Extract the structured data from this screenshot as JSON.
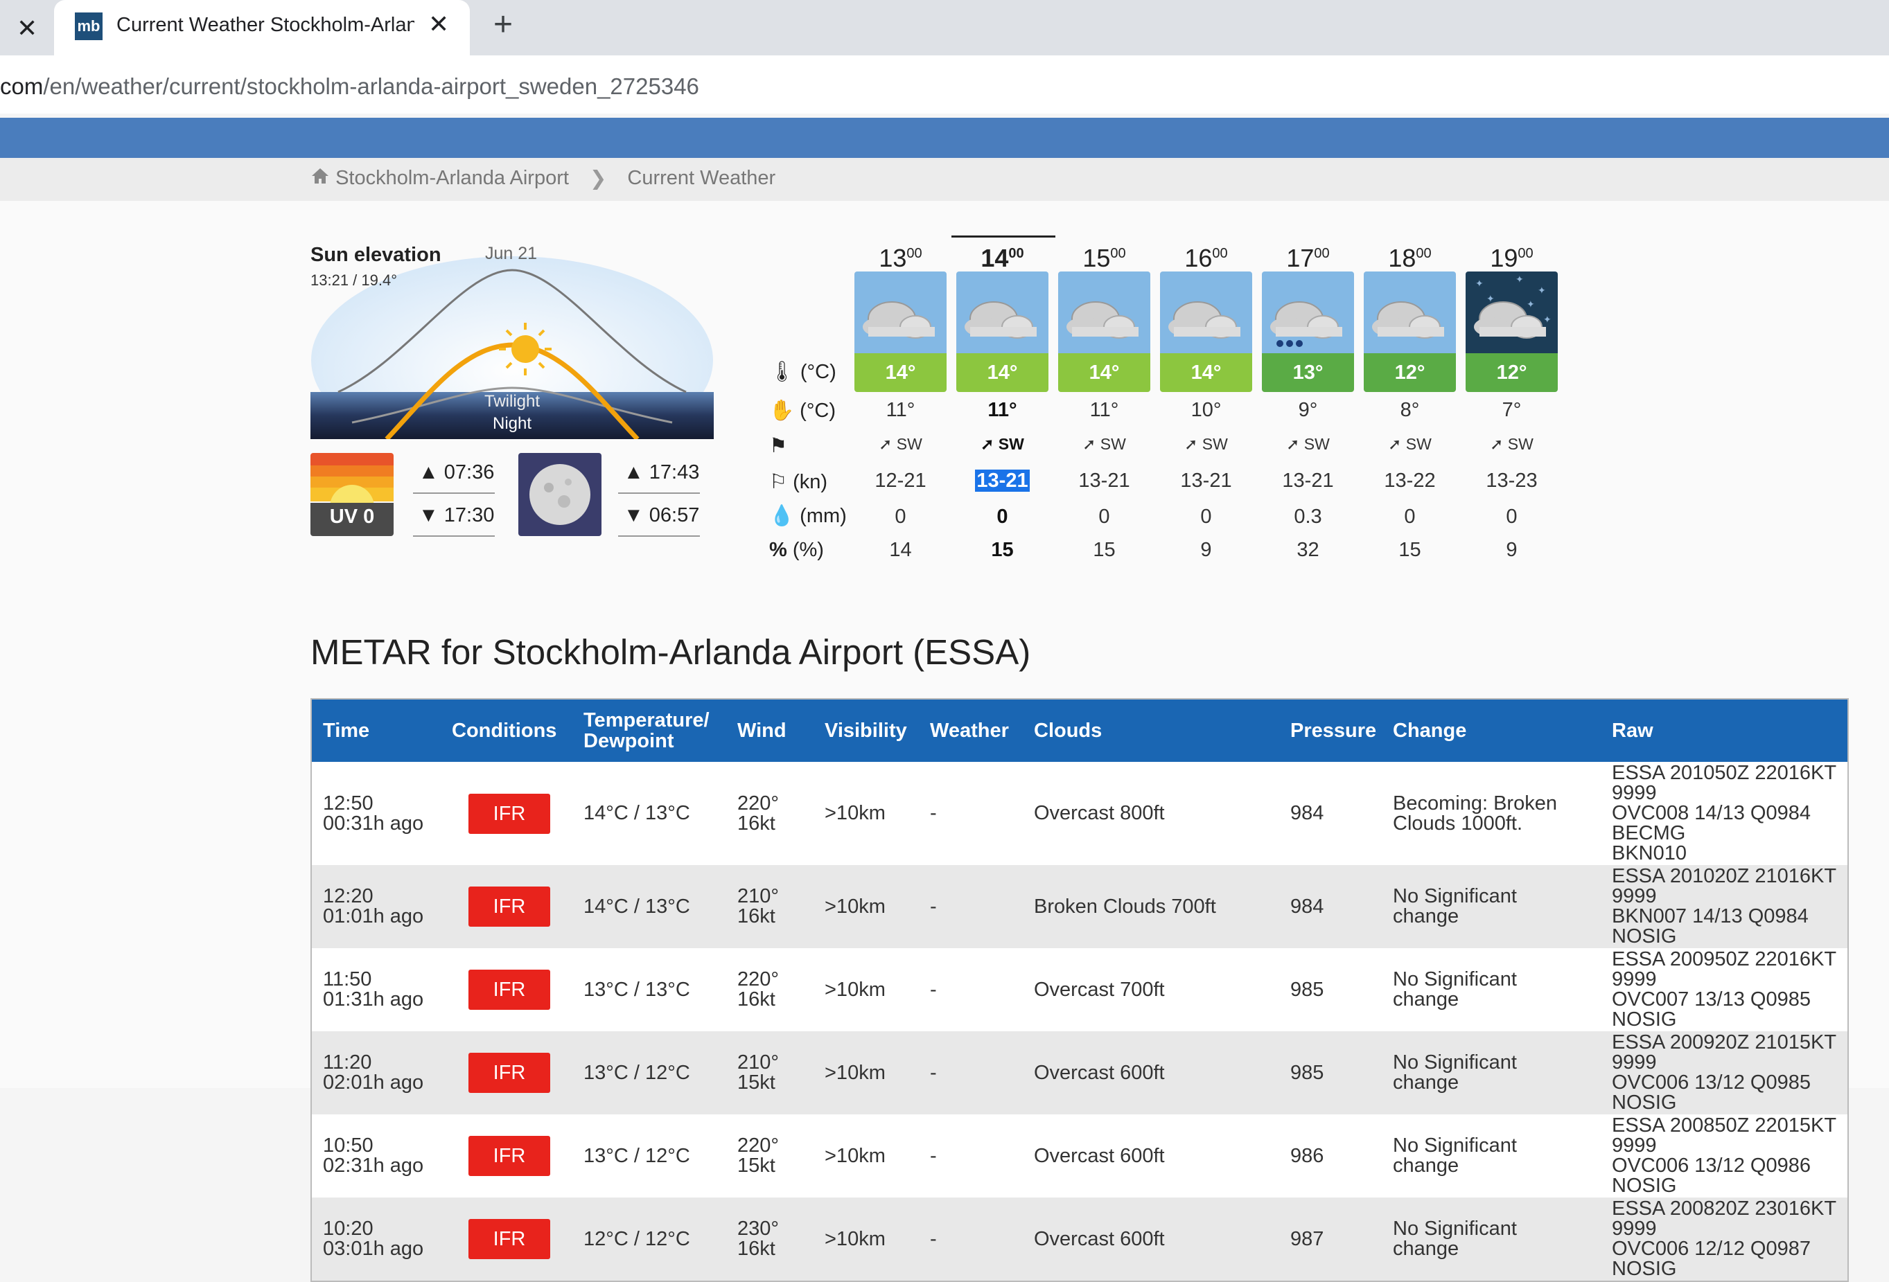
{
  "browser": {
    "prev_tab_close": "✕",
    "tab_title": "Current Weather Stockholm-Arlanda Airport",
    "tab_close": "✕",
    "favicon": "mb",
    "new_tab": "+",
    "url_host": "com",
    "url_path": "/en/weather/current/stockholm-arlanda-airport_sweden_2725346"
  },
  "breadcrumb": {
    "home_icon": "house-icon",
    "item1": "Stockholm-Arlanda Airport",
    "separator": "❯",
    "item2": "Current Weather"
  },
  "sun": {
    "title": "Sun elevation",
    "subtitle": "13:21 / 19.4°",
    "date": "Jun 21",
    "twilight": "Twilight",
    "night": "Night",
    "uv": "UV 0",
    "sunrise": "▲ 07:36",
    "sunset": "▼ 17:30",
    "moonrise": "▲ 17:43",
    "moonset": "▼ 06:57"
  },
  "row_labels": {
    "temp": "(°C)",
    "felt": "(°C)",
    "wind": "(kn)",
    "precip": "(mm)",
    "prob": "(%)"
  },
  "forecast": [
    {
      "hour": "13",
      "min": "00",
      "temp": "14°",
      "felt": "11°",
      "dir": "SW",
      "wind": "12-21",
      "precip": "0",
      "prob": "14",
      "tile": "#83b8e4",
      "tcolor": "#8cc63f",
      "icon": "cloud-icon"
    },
    {
      "hour": "14",
      "min": "00",
      "temp": "14°",
      "felt": "11°",
      "dir": "SW",
      "wind": "13-21",
      "precip": "0",
      "prob": "15",
      "tile": "#83b8e4",
      "tcolor": "#8cc63f",
      "icon": "cloud-icon"
    },
    {
      "hour": "15",
      "min": "00",
      "temp": "14°",
      "felt": "11°",
      "dir": "SW",
      "wind": "13-21",
      "precip": "0",
      "prob": "15",
      "tile": "#83b8e4",
      "tcolor": "#8cc63f",
      "icon": "cloud-icon"
    },
    {
      "hour": "16",
      "min": "00",
      "temp": "14°",
      "felt": "10°",
      "dir": "SW",
      "wind": "13-21",
      "precip": "0",
      "prob": "9",
      "tile": "#83b8e4",
      "tcolor": "#8cc63f",
      "icon": "cloud-icon"
    },
    {
      "hour": "17",
      "min": "00",
      "temp": "13°",
      "felt": "9°",
      "dir": "SW",
      "wind": "13-21",
      "precip": "0.3",
      "prob": "32",
      "tile": "#83b8e4",
      "tcolor": "#5aab45",
      "icon": "rain-cloud-icon"
    },
    {
      "hour": "18",
      "min": "00",
      "temp": "12°",
      "felt": "8°",
      "dir": "SW",
      "wind": "13-22",
      "precip": "0",
      "prob": "15",
      "tile": "#83b8e4",
      "tcolor": "#5aab45",
      "icon": "cloud-icon"
    },
    {
      "hour": "19",
      "min": "00",
      "temp": "12°",
      "felt": "7°",
      "dir": "SW",
      "wind": "13-23",
      "precip": "0",
      "prob": "9",
      "tile": "#1c3d57",
      "tcolor": "#5aab45",
      "icon": "night-cloud-icon"
    }
  ],
  "metar": {
    "title": "METAR for Stockholm-Arlanda Airport (ESSA)",
    "headers": {
      "time": "Time",
      "conditions": "Conditions",
      "temp1": "Temperature/",
      "temp2": "Dewpoint",
      "wind": "Wind",
      "visibility": "Visibility",
      "weather": "Weather",
      "clouds": "Clouds",
      "pressure": "Pressure",
      "change": "Change",
      "raw": "Raw"
    },
    "rows": [
      {
        "time": "12:50",
        "ago": "00:31h ago",
        "cond": "IFR",
        "temp": "14°C / 13°C",
        "wdir": "220°",
        "wspd": "16kt",
        "vis": ">10km",
        "wx": "-",
        "clouds": "Overcast 800ft",
        "pres": "984",
        "chg1": "Becoming: Broken",
        "chg2": "Clouds 1000ft.",
        "raw1": "ESSA 201050Z 22016KT 9999",
        "raw2": "OVC008 14/13 Q0984 BECMG",
        "raw3": "BKN010"
      },
      {
        "time": "12:20",
        "ago": "01:01h ago",
        "cond": "IFR",
        "temp": "14°C / 13°C",
        "wdir": "210°",
        "wspd": "16kt",
        "vis": ">10km",
        "wx": "-",
        "clouds": "Broken Clouds 700ft",
        "pres": "984",
        "chg1": "No Significant",
        "chg2": "change",
        "raw1": "ESSA 201020Z 21016KT 9999",
        "raw2": "BKN007 14/13 Q0984 NOSIG",
        "raw3": ""
      },
      {
        "time": "11:50",
        "ago": "01:31h ago",
        "cond": "IFR",
        "temp": "13°C / 13°C",
        "wdir": "220°",
        "wspd": "16kt",
        "vis": ">10km",
        "wx": "-",
        "clouds": "Overcast 700ft",
        "pres": "985",
        "chg1": "No Significant",
        "chg2": "change",
        "raw1": "ESSA 200950Z 22016KT 9999",
        "raw2": "OVC007 13/13 Q0985 NOSIG",
        "raw3": ""
      },
      {
        "time": "11:20",
        "ago": "02:01h ago",
        "cond": "IFR",
        "temp": "13°C / 12°C",
        "wdir": "210°",
        "wspd": "15kt",
        "vis": ">10km",
        "wx": "-",
        "clouds": "Overcast 600ft",
        "pres": "985",
        "chg1": "No Significant",
        "chg2": "change",
        "raw1": "ESSA 200920Z 21015KT 9999",
        "raw2": "OVC006 13/12 Q0985 NOSIG",
        "raw3": ""
      },
      {
        "time": "10:50",
        "ago": "02:31h ago",
        "cond": "IFR",
        "temp": "13°C / 12°C",
        "wdir": "220°",
        "wspd": "15kt",
        "vis": ">10km",
        "wx": "-",
        "clouds": "Overcast 600ft",
        "pres": "986",
        "chg1": "No Significant",
        "chg2": "change",
        "raw1": "ESSA 200850Z 22015KT 9999",
        "raw2": "OVC006 13/12 Q0986 NOSIG",
        "raw3": ""
      },
      {
        "time": "10:20",
        "ago": "03:01h ago",
        "cond": "IFR",
        "temp": "12°C / 12°C",
        "wdir": "230°",
        "wspd": "16kt",
        "vis": ">10km",
        "wx": "-",
        "clouds": "Overcast 600ft",
        "pres": "987",
        "chg1": "No Significant",
        "chg2": "change",
        "raw1": "ESSA 200820Z 23016KT 9999",
        "raw2": "OVC006 12/12 Q0987 NOSIG",
        "raw3": ""
      }
    ]
  },
  "colors": {
    "ifr": "#e8231c",
    "header_blue": "#1a66b3",
    "nav_blue": "#4a7dbd",
    "highlight": "#1a73e8"
  }
}
